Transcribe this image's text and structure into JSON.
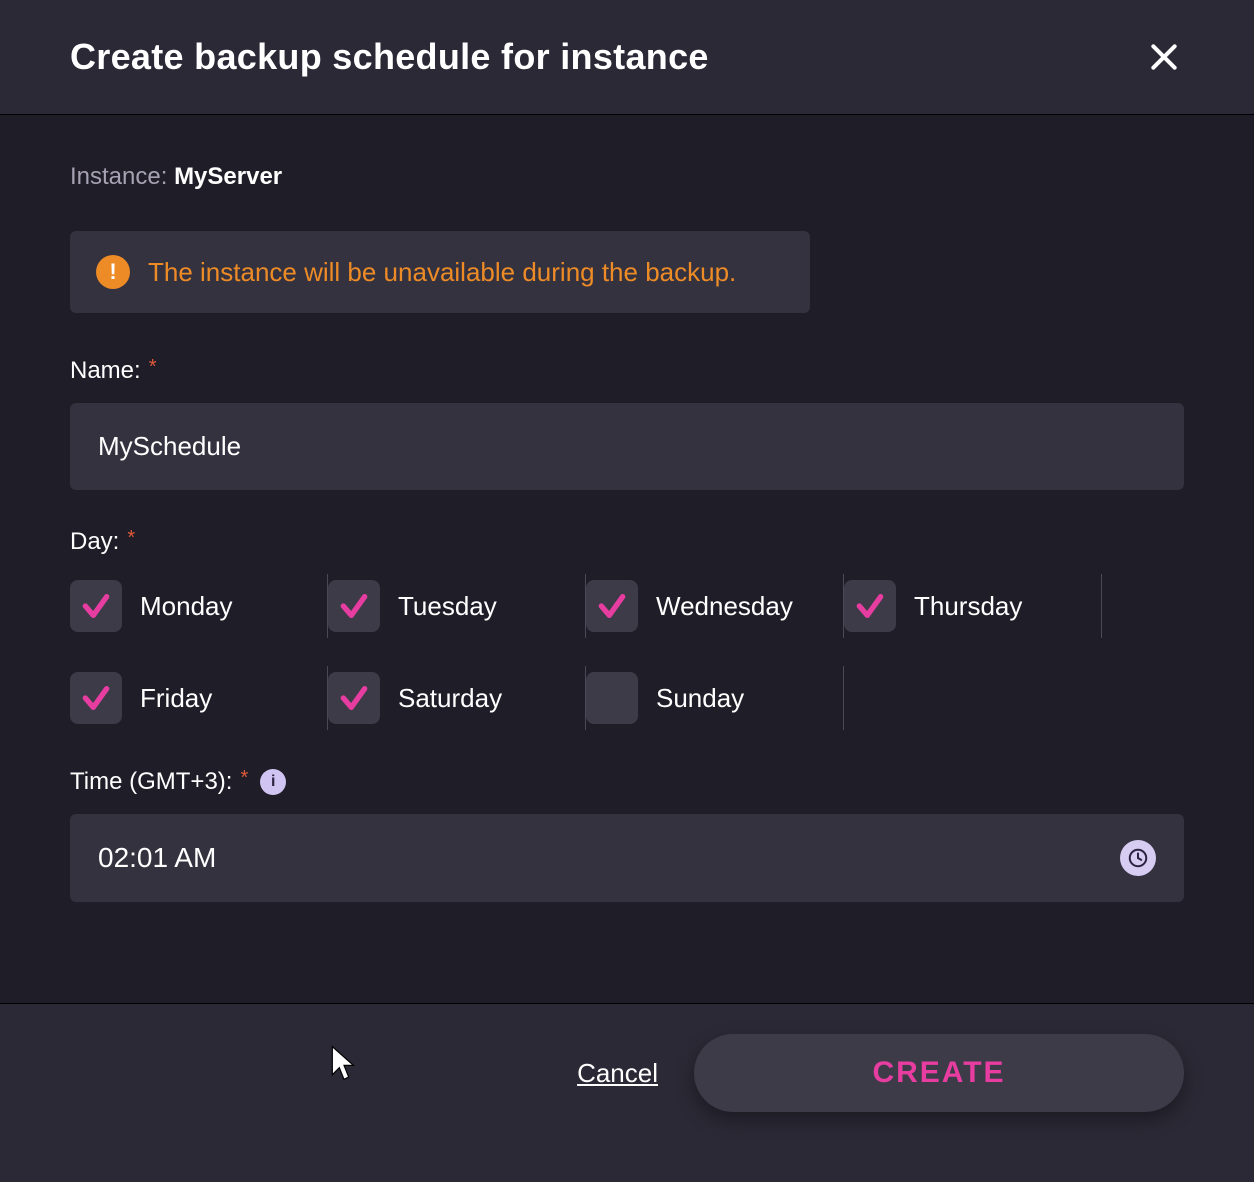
{
  "header": {
    "title": "Create backup schedule for instance"
  },
  "instance": {
    "label": "Instance: ",
    "name": "MyServer"
  },
  "warning": {
    "text": "The instance will be unavailable during the backup."
  },
  "name_field": {
    "label": "Name:",
    "value": "MySchedule"
  },
  "day_field": {
    "label": "Day:",
    "days": [
      {
        "label": "Monday",
        "checked": true
      },
      {
        "label": "Tuesday",
        "checked": true
      },
      {
        "label": "Wednesday",
        "checked": true
      },
      {
        "label": "Thursday",
        "checked": true
      },
      {
        "label": "Friday",
        "checked": true
      },
      {
        "label": "Saturday",
        "checked": true
      },
      {
        "label": "Sunday",
        "checked": false
      }
    ]
  },
  "time_field": {
    "label": "Time (GMT+3):",
    "value": "02:01 AM"
  },
  "footer": {
    "cancel": "Cancel",
    "create": "CREATE"
  }
}
